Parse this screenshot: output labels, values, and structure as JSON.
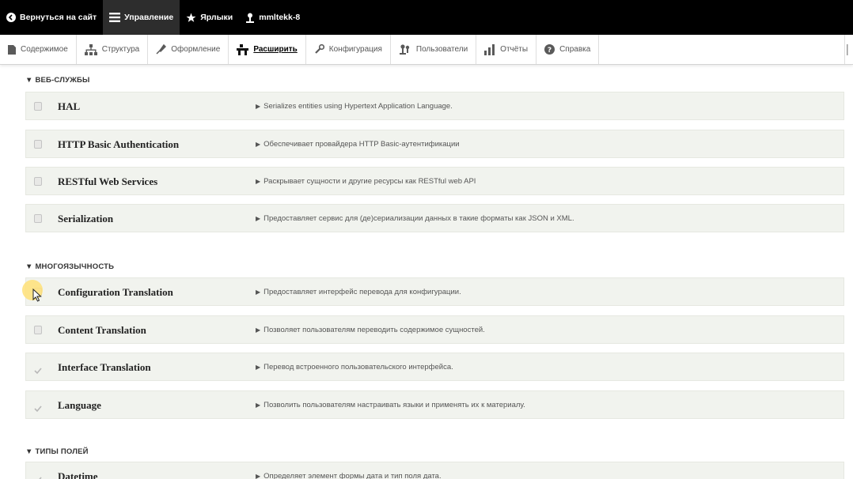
{
  "toolbar": {
    "back": "Вернуться на сайт",
    "manage": "Управление",
    "shortcuts": "Ярлыки",
    "user": "mmltekk-8"
  },
  "tray": {
    "items": [
      {
        "label": "Содержимое",
        "icon": "content-icon"
      },
      {
        "label": "Структура",
        "icon": "structure-icon"
      },
      {
        "label": "Оформление",
        "icon": "appearance-icon"
      },
      {
        "label": "Расширить",
        "icon": "extend-icon",
        "active": true
      },
      {
        "label": "Конфигурация",
        "icon": "wrench-icon"
      },
      {
        "label": "Пользователи",
        "icon": "people-icon"
      },
      {
        "label": "Отчёты",
        "icon": "reports-icon"
      },
      {
        "label": "Справка",
        "icon": "help-icon"
      }
    ]
  },
  "groups": [
    {
      "title": "▼ ВЕБ-СЛУЖБЫ",
      "modules": [
        {
          "name": "HAL",
          "description": "Serializes entities using Hypertext Application Language.",
          "checked": false
        },
        {
          "name": "HTTP Basic Authentication",
          "description": "Обеспечивает провайдера HTTP Basic-аутентификации",
          "checked": false
        },
        {
          "name": "RESTful Web Services",
          "description": "Раскрывает сущности и другие ресурсы как RESTful web API",
          "checked": false
        },
        {
          "name": "Serialization",
          "description": "Предоставляет сервис для (де)сериализации данных в такие форматы как JSON и XML.",
          "checked": false
        }
      ]
    },
    {
      "title": "▼ МНОГОЯЗЫЧНОСТЬ",
      "modules": [
        {
          "name": "Configuration Translation",
          "description": "Предоставляет интерфейс перевода для конфигурации.",
          "checked": false
        },
        {
          "name": "Content Translation",
          "description": "Позволяет пользователям переводить содержимое сущностей.",
          "checked": false
        },
        {
          "name": "Interface Translation",
          "description": "Перевод встроенного пользовательского интерфейса.",
          "checked": true
        },
        {
          "name": "Language",
          "description": "Позволить пользователям настраивать языки и применять их к материалу.",
          "checked": true
        }
      ]
    },
    {
      "title": "▼ ТИПЫ ПОЛЕЙ",
      "modules": [
        {
          "name": "Datetime",
          "description": "Определяет элемент формы дата и тип поля дата.",
          "checked": true
        }
      ]
    }
  ],
  "colors": {
    "toolbar_bg": "#000000",
    "row_bg": "#f1f3ee",
    "text_dark": "#222222",
    "cursor_highlight": "#ffe078"
  }
}
